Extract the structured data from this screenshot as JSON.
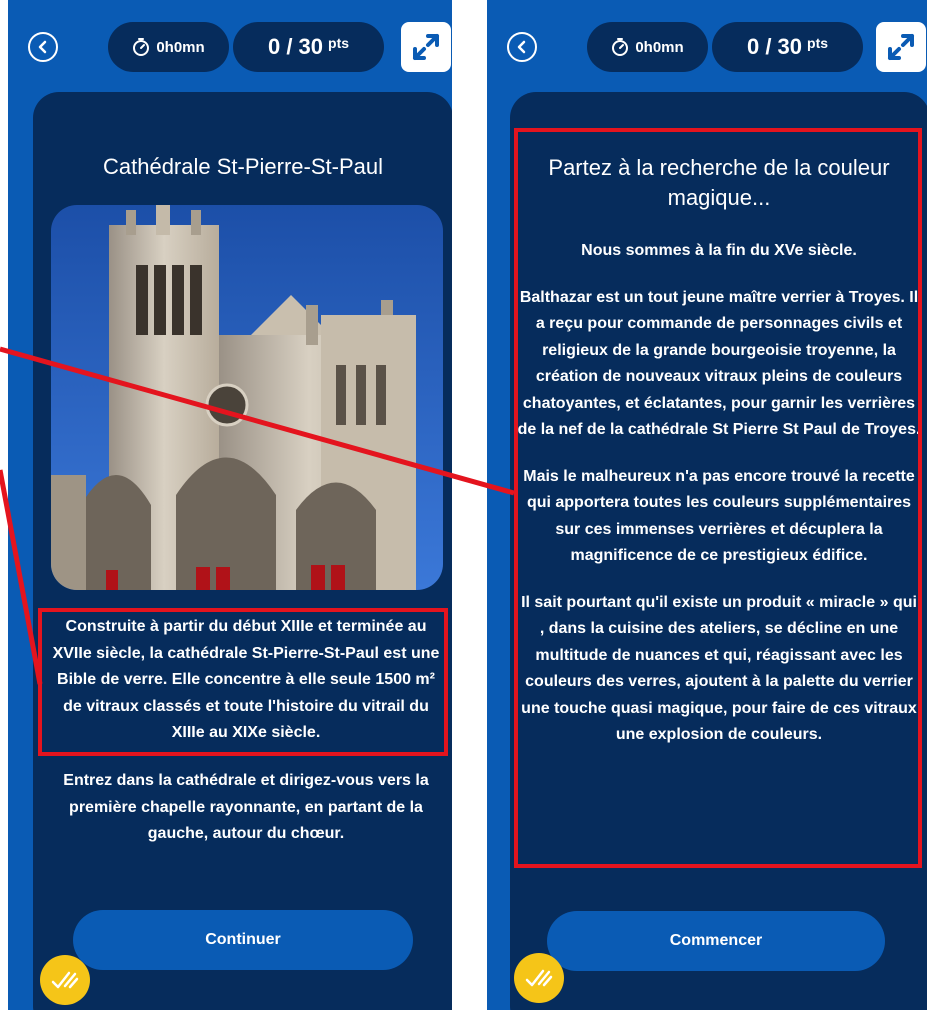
{
  "colors": {
    "phone_background": "#0a5bb4",
    "card_background": "#062c5c",
    "highlight_red": "#e4141e",
    "badge_yellow": "#f5c518"
  },
  "left_screen": {
    "header": {
      "back_icon": "chevron-left-circle-icon",
      "timer_icon": "stopwatch-icon",
      "timer_label": "0h0mn",
      "score_label": "0 / 30",
      "score_unit": "pts",
      "expand_icon": "expand-arrows-icon"
    },
    "title": "Cathédrale St-Pierre-St-Paul",
    "photo_alt": "Cathédrale St-Pierre-St-Paul",
    "highlighted_text": "Construite à partir du début XIIIe et terminée au XVIIe siècle, la cathédrale St-Pierre-St-Paul est une Bible de verre. Elle concentre à elle seule 1500 m² de vitraux classés et toute l'histoire du vitrail du XIIIe au XIXe siècle.",
    "instruction_text": "Entrez dans la cathédrale et dirigez-vous vers la première chapelle rayonnante, en partant de la gauche, autour du chœur.",
    "button_label": "Continuer",
    "badge_icon": "check-ticks-icon"
  },
  "right_screen": {
    "header": {
      "back_icon": "chevron-left-circle-icon",
      "timer_icon": "stopwatch-icon",
      "timer_label": "0h0mn",
      "score_label": "0 / 30",
      "score_unit": "pts",
      "expand_icon": "expand-arrows-icon"
    },
    "title": "Partez à la recherche de la couleur magique...",
    "paragraphs": [
      "Nous sommes à la fin du XVe siècle.",
      "Balthazar est un tout jeune maître verrier à Troyes. Il a reçu pour commande de personnages civils et religieux de la grande bourgeoisie troyenne, la création de nouveaux vitraux pleins de couleurs chatoyantes, et éclatantes, pour garnir les verrières de la nef de la cathédrale St Pierre St Paul de Troyes.",
      "Mais le malheureux n'a pas encore trouvé la recette qui apportera toutes les couleurs supplémentaires sur ces immenses verrières et décuplera la magnificence de ce prestigieux édifice.",
      "Il sait pourtant qu'il existe un produit « miracle » qui , dans la cuisine des ateliers, se décline en une multitude de nuances et qui, réagissant avec les couleurs des verres, ajoutent à la palette du verrier une touche quasi magique, pour faire de ces vitraux une explosion de couleurs."
    ],
    "button_label": "Commencer",
    "badge_icon": "check-ticks-icon"
  }
}
